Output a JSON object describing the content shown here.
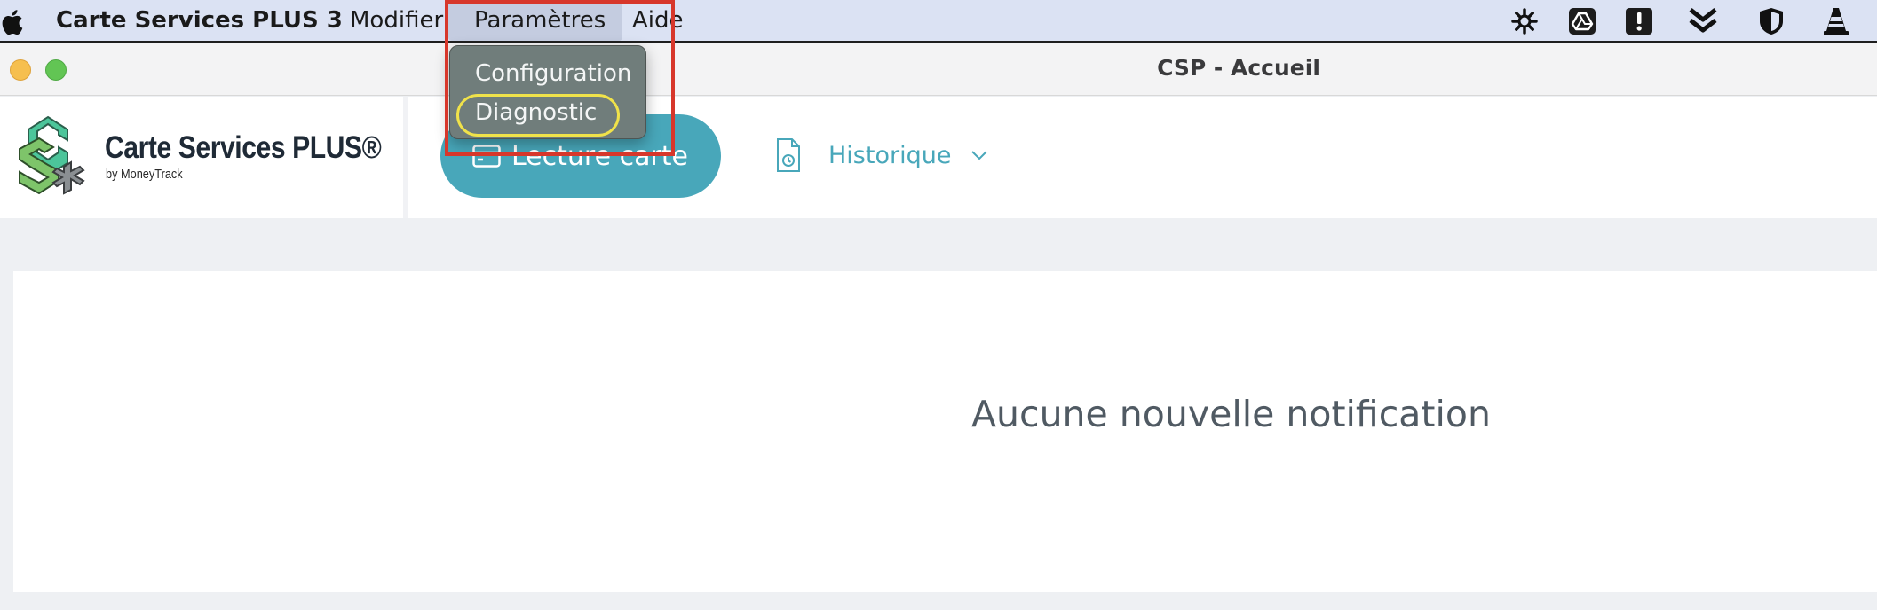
{
  "menubar": {
    "apple_icon": "apple-logo-icon",
    "app_name": "Carte Services PLUS 3",
    "items": [
      "Modifier",
      "Paramètres",
      "Aide"
    ],
    "status_icons": [
      "burst-icon",
      "drive-icon",
      "alert-icon",
      "double-chevron-down-icon",
      "shield-icon",
      "traffic-cone-icon"
    ]
  },
  "window": {
    "title": "CSP - Accueil"
  },
  "logo": {
    "title": "Carte Services PLUS®",
    "subtitle": "by MoneyTrack"
  },
  "nav": {
    "lecture_label": "Lecture carte",
    "historique_label": "Historique"
  },
  "dropdown": {
    "items": [
      "Configuration",
      "Diagnostic"
    ]
  },
  "content": {
    "notification": "Aucune nouvelle notification"
  },
  "colors": {
    "accent": "#48a7ba",
    "menubar_bg": "#dbe2f3",
    "dropdown_bg": "#707d7b",
    "annotation_red": "#d7372b",
    "annotation_yellow": "#f0e24a"
  }
}
